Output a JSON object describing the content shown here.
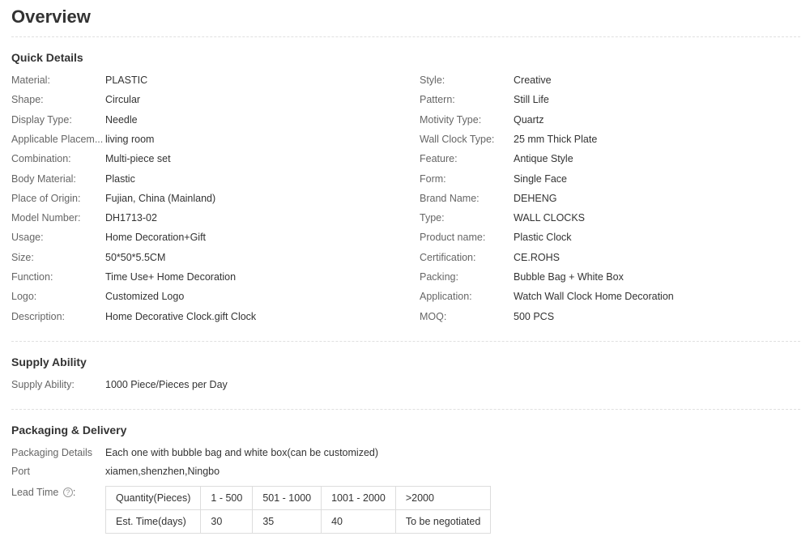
{
  "page": {
    "title": "Overview"
  },
  "quick_details": {
    "heading": "Quick Details",
    "left": [
      {
        "label": "Material:",
        "value": "PLASTIC"
      },
      {
        "label": "Shape:",
        "value": "Circular"
      },
      {
        "label": "Display Type:",
        "value": "Needle"
      },
      {
        "label": "Applicable Placem...",
        "value": "living room"
      },
      {
        "label": "Combination:",
        "value": "Multi-piece set"
      },
      {
        "label": "Body Material:",
        "value": "Plastic"
      },
      {
        "label": "Place of Origin:",
        "value": "Fujian, China (Mainland)"
      },
      {
        "label": "Model Number:",
        "value": "DH1713-02"
      },
      {
        "label": "Usage:",
        "value": "Home Decoration+Gift"
      },
      {
        "label": "Size:",
        "value": "50*50*5.5CM"
      },
      {
        "label": "Function:",
        "value": "Time Use+ Home Decoration"
      },
      {
        "label": "Logo:",
        "value": "Customized Logo"
      },
      {
        "label": "Description:",
        "value": "Home Decorative Clock.gift Clock"
      }
    ],
    "right": [
      {
        "label": "Style:",
        "value": "Creative"
      },
      {
        "label": "Pattern:",
        "value": "Still Life"
      },
      {
        "label": "Motivity Type:",
        "value": "Quartz"
      },
      {
        "label": "Wall Clock Type:",
        "value": "25 mm Thick Plate"
      },
      {
        "label": "Feature:",
        "value": "Antique Style"
      },
      {
        "label": "Form:",
        "value": "Single Face"
      },
      {
        "label": "Brand Name:",
        "value": "DEHENG"
      },
      {
        "label": "Type:",
        "value": "WALL CLOCKS"
      },
      {
        "label": "Product name:",
        "value": "Plastic Clock"
      },
      {
        "label": "Certification:",
        "value": "CE.ROHS"
      },
      {
        "label": "Packing:",
        "value": "Bubble Bag + White Box"
      },
      {
        "label": "Application:",
        "value": "Watch Wall Clock Home Decoration"
      },
      {
        "label": "MOQ:",
        "value": "500 PCS"
      }
    ]
  },
  "supply_ability": {
    "heading": "Supply Ability",
    "label": "Supply Ability:",
    "value": "1000 Piece/Pieces per Day"
  },
  "packaging": {
    "heading": "Packaging & Delivery",
    "details_label": "Packaging Details",
    "details_value": "Each one with bubble bag and white box(can be customized)",
    "port_label": "Port",
    "port_value": "xiamen,shenzhen,Ningbo",
    "lead_time_label": "Lead Time",
    "help_icon_glyph": "?",
    "lead_table": {
      "header": [
        "Quantity(Pieces)",
        "1 - 500",
        "501 - 1000",
        "1001 - 2000",
        ">2000"
      ],
      "row": [
        "Est. Time(days)",
        "30",
        "35",
        "40",
        "To be negotiated"
      ]
    }
  }
}
